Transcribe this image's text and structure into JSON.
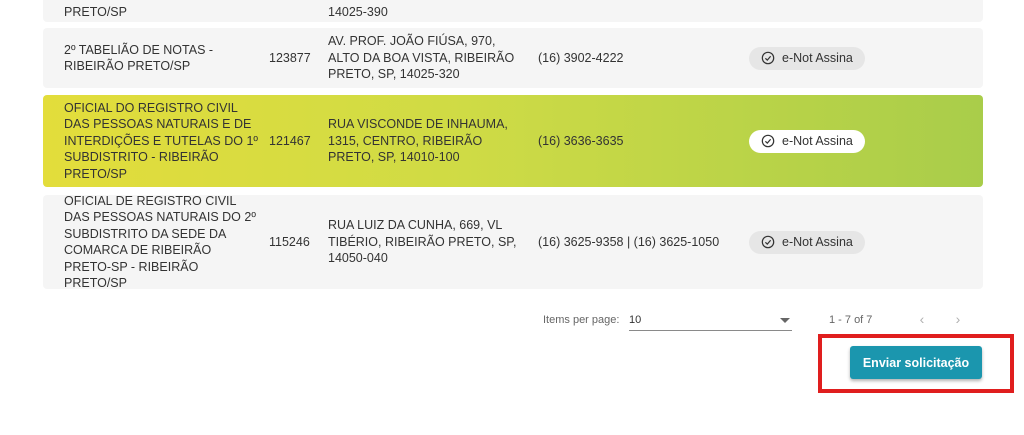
{
  "rows": [
    {
      "name": "PRETO/SP",
      "address": "14025-390"
    },
    {
      "name": "2º TABELIÃO DE NOTAS - RIBEIRÃO PRETO/SP",
      "code": "123877",
      "address": "AV. PROF. JOÃO FIÚSA, 970, ALTO DA BOA VISTA, RIBEIRÃO PRETO, SP, 14025-320",
      "phone": "(16) 3902-4222",
      "badge": "e-Not Assina"
    },
    {
      "name": "OFICIAL DO REGISTRO CIVIL DAS PESSOAS NATURAIS E DE INTERDIÇÕES E TUTELAS DO 1º SUBDISTRITO - RIBEIRÃO PRETO/SP",
      "code": "121467",
      "address": "RUA VISCONDE DE INHAUMA, 1315, CENTRO, RIBEIRÃO PRETO, SP, 14010-100",
      "phone": "(16) 3636-3635",
      "badge": "e-Not Assina"
    },
    {
      "name": "OFICIAL DE REGISTRO CIVIL DAS PESSOAS NATURAIS DO 2º SUBDISTRITO DA SEDE DA COMARCA DE RIBEIRÃO PRETO-SP - RIBEIRÃO PRETO/SP",
      "code": "115246",
      "address": "RUA LUIZ DA CUNHA, 669, VL TIBÉRIO, RIBEIRÃO PRETO, SP, 14050-040",
      "phone": "(16) 3625-9358 | (16) 3625-1050",
      "badge": "e-Not Assina"
    }
  ],
  "paginator": {
    "items_per_page_label": "Items per page:",
    "items_per_page_value": "10",
    "range_label": "1 - 7 of 7",
    "prev_icon": "chevron-left",
    "next_icon": "chevron-right"
  },
  "actions": {
    "submit_label": "Enviar solicitação"
  },
  "colors": {
    "highlight_row": "#cfdb45",
    "button": "#1b96ae",
    "annotation_box": "#e01e1e"
  }
}
